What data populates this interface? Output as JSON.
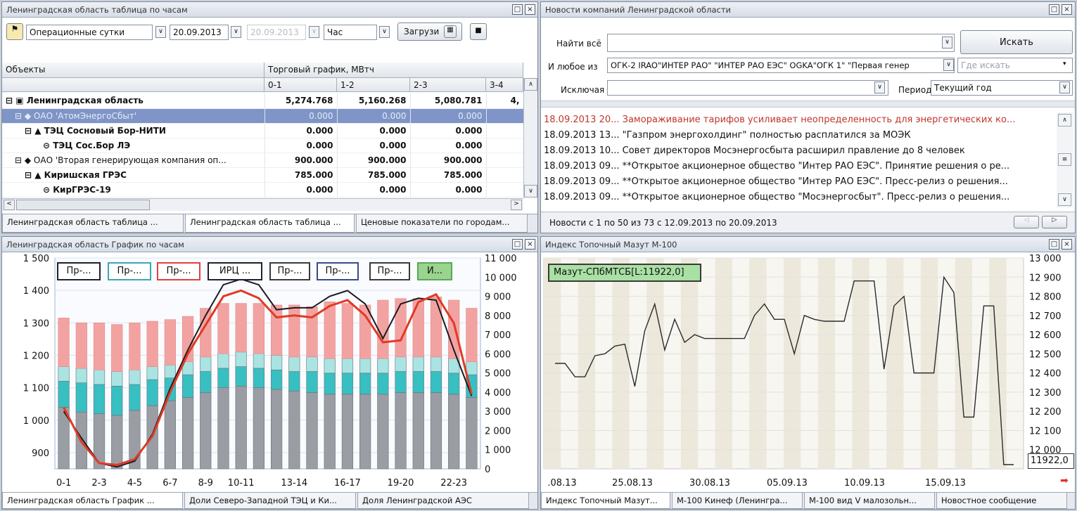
{
  "table_panel": {
    "title": "Ленинградская область таблица по часам",
    "period": "Операционные сутки",
    "date_from": "20.09.2013",
    "date_to": "20.09.2013",
    "granularity": "Час",
    "load_label": "Загрузи",
    "col_objects": "Объекты",
    "col_group": "Торговый график, МВтч",
    "hours": [
      "0-1",
      "1-2",
      "2-3",
      "3-4"
    ],
    "rows": [
      {
        "name": "Ленинградская область",
        "v": [
          "5,274.768",
          "5,160.268",
          "5,080.781",
          "4,"
        ]
      },
      {
        "name": "ОАО 'АтомЭнергоСбыт'",
        "v": [
          "0.000",
          "0.000",
          "0.000",
          ""
        ]
      },
      {
        "name": "ТЭЦ Сосновый Бор-НИТИ",
        "v": [
          "0.000",
          "0.000",
          "0.000",
          ""
        ]
      },
      {
        "name": "ТЭЦ Сос.Бор ЛЭ",
        "v": [
          "0.000",
          "0.000",
          "0.000",
          ""
        ]
      },
      {
        "name": "ОАО 'Вторая генерирующая компания оп...",
        "v": [
          "900.000",
          "900.000",
          "900.000",
          ""
        ]
      },
      {
        "name": "Киришская ГРЭС",
        "v": [
          "785.000",
          "785.000",
          "785.000",
          ""
        ]
      },
      {
        "name": "КирГРЭС-19",
        "v": [
          "0.000",
          "0.000",
          "0.000",
          ""
        ]
      }
    ],
    "tabs": [
      "Ленинградская область таблица ...",
      "Ленинградская область таблица ...",
      "Ценовые показатели по городам..."
    ]
  },
  "news_panel": {
    "title": "Новости компаний Ленинградской области",
    "find_all_label": "Найти всё",
    "find_all_value": "",
    "search_button": "Искать",
    "any_of_label": "И любое из",
    "any_of_value": "ОГК-2 IRAO\"ИНТЕР РАО\" \"ИНТЕР РАО ЕЭС\" OGKA\"ОГК 1\" \"Первая генер",
    "where_placeholder": "Где искать",
    "exclude_label": "Исключая",
    "exclude_value": "",
    "period_label": "Период",
    "period_value": "Текущий год",
    "items": [
      {
        "text": "18.09.2013 20... Замораживание тарифов усиливает неопределенность для энергетических ко...",
        "highlight": true
      },
      {
        "text": "18.09.2013 13... \"Газпром энергохолдинг\" полностью расплатился за МОЭК",
        "highlight": false
      },
      {
        "text": "18.09.2013 10... Совет директоров Мосэнергосбыта расширил правление до 8 человек",
        "highlight": false
      },
      {
        "text": "18.09.2013 09... **Открытое акционерное общество \"Интер РАО ЕЭС\". Принятие решения о ре...",
        "highlight": false
      },
      {
        "text": "18.09.2013 09... **Открытое акционерное общество \"Интер РАО ЕЭС\". Пресс-релиз о решения...",
        "highlight": false
      },
      {
        "text": "18.09.2013 09... **Открытое акционерное общество \"Мосэнергосбыт\". Пресс-релиз о решения...",
        "highlight": false
      }
    ],
    "status": "Новости с 1 по 50 из 73 с 12.09.2013 по 20.09.2013"
  },
  "chart_panel": {
    "title": "Ленинградская область График по часам",
    "legend": [
      "Пр-...",
      "Пр-...",
      "Пр-...",
      "ИРЦ ...",
      "Пр-...",
      "Пр-...",
      "Пр-...",
      "И..."
    ],
    "tabs": [
      "Ленинградская область График ...",
      "Доли Северо-Западной ТЭЦ и Ки...",
      "Доля Ленинградской АЭС"
    ]
  },
  "index_panel": {
    "title": "Индекс Топочный Мазут М-100",
    "legend": "Мазут-СПбМТСБ[L:11922,0]",
    "last_value": "11922,0",
    "tabs": [
      "Индекс Топочный Мазут...",
      "М-100 Кинеф (Ленингра...",
      "М-100 вид V малозольн...",
      "Новостное сообщение"
    ]
  },
  "chart_data": [
    {
      "type": "bar",
      "title": "",
      "categories": [
        "0-1",
        "1-2",
        "2-3",
        "3-4",
        "4-5",
        "5-6",
        "6-7",
        "7-8",
        "8-9",
        "9-10",
        "10-11",
        "11-12",
        "12-13",
        "13-14",
        "14-15",
        "15-16",
        "16-17",
        "17-18",
        "18-19",
        "19-20",
        "20-21",
        "21-22",
        "22-23",
        "23-24"
      ],
      "x_tick_labels": [
        "0-1",
        "2-3",
        "4-5",
        "6-7",
        "8-9",
        "10-11",
        "13-14",
        "16-17",
        "19-20",
        "22-23"
      ],
      "ylim_left": [
        850,
        1500
      ],
      "yticks_left": [
        "1 500",
        "1 400",
        "1 300",
        "1 200",
        "1 100",
        "1 000",
        "900"
      ],
      "ylim_right": [
        0,
        11000
      ],
      "yticks_right": [
        "11 000",
        "10 000",
        "9 000",
        "8 000",
        "7 000",
        "6 000",
        "5 000",
        "4 000",
        "3 000",
        "2 000",
        "1 000",
        "0"
      ],
      "series": [
        {
          "values": [
            1040,
            1025,
            1020,
            1015,
            1030,
            1045,
            1060,
            1070,
            1085,
            1100,
            1105,
            1100,
            1095,
            1090,
            1085,
            1080,
            1080,
            1080,
            1080,
            1085,
            1085,
            1085,
            1080,
            1070
          ]
        },
        {
          "values": [
            1120,
            1115,
            1110,
            1105,
            1110,
            1125,
            1130,
            1140,
            1150,
            1160,
            1165,
            1160,
            1155,
            1150,
            1150,
            1145,
            1145,
            1145,
            1145,
            1150,
            1150,
            1150,
            1145,
            1140
          ]
        },
        {
          "values": [
            1165,
            1160,
            1155,
            1150,
            1155,
            1165,
            1170,
            1180,
            1195,
            1205,
            1210,
            1205,
            1200,
            1195,
            1195,
            1190,
            1190,
            1190,
            1190,
            1195,
            1195,
            1195,
            1190,
            1180
          ]
        },
        {
          "values": [
            1315,
            1300,
            1300,
            1295,
            1300,
            1305,
            1310,
            1320,
            1345,
            1360,
            1360,
            1360,
            1355,
            1355,
            1350,
            1365,
            1360,
            1355,
            1370,
            1375,
            1375,
            1380,
            1370,
            1345
          ]
        },
        {
          "values": [
            3000,
            1600,
            300,
            100,
            400,
            1800,
            4200,
            6200,
            8000,
            9600,
            9900,
            9600,
            8300,
            8400,
            8400,
            9000,
            9300,
            8600,
            6800,
            8600,
            8900,
            8800,
            6200,
            3800
          ]
        },
        {
          "values": [
            3200,
            1400,
            300,
            200,
            500,
            1700,
            4000,
            6000,
            7500,
            9000,
            9300,
            8900,
            7900,
            8000,
            7900,
            8500,
            8800,
            8000,
            6600,
            6700,
            8700,
            9100,
            7600,
            3900
          ]
        }
      ]
    },
    {
      "type": "line",
      "title": "",
      "x_tick_labels": [
        ".08.13",
        "25.08.13",
        "30.08.13",
        "05.09.13",
        "10.09.13",
        "15.09.13"
      ],
      "ylim": [
        11900,
        13000
      ],
      "yticks": [
        "13 000",
        "12 900",
        "12 800",
        "12 700",
        "12 600",
        "12 500",
        "12 400",
        "12 300",
        "12 200",
        "12 100",
        "12 000"
      ],
      "series": [
        {
          "name": "Мазут-СПбМТСБ",
          "values": [
            12450,
            12450,
            12380,
            12380,
            12490,
            12500,
            12540,
            12550,
            12330,
            12620,
            12760,
            12520,
            12680,
            12560,
            12600,
            12580,
            12580,
            12580,
            12580,
            12580,
            12700,
            12760,
            12680,
            12680,
            12500,
            12700,
            12680,
            12670,
            12670,
            12670,
            12880,
            12880,
            12880,
            12420,
            12750,
            12800,
            12400,
            12400,
            12400,
            12900,
            12820,
            12170,
            12170,
            12750,
            12750,
            11922,
            11922
          ]
        }
      ]
    }
  ]
}
